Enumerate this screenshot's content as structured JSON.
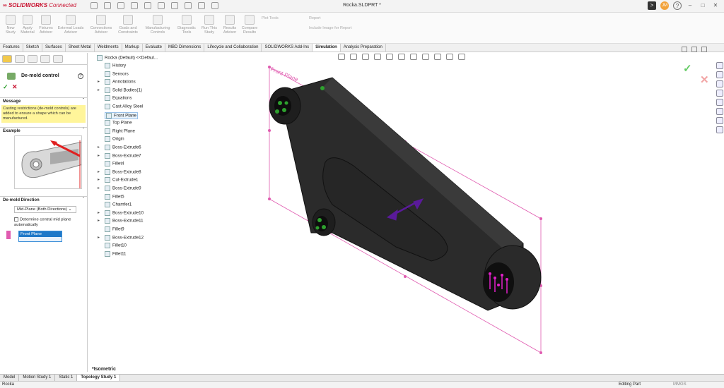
{
  "titlebar": {
    "brand": "SOLIDWORKS",
    "brand_suffix": "Connected",
    "document": "Rocka.SLDPRT *",
    "avatar": "JM"
  },
  "ribbon": {
    "buttons": [
      "New Study",
      "Apply Material",
      "Fixtures Advisor",
      "External Loads Advisor",
      "Connections Advisor",
      "Goals and Constraints",
      "Manufacturing Controls",
      "Diagnostic Tools",
      "Run This Study",
      "Results Advisor",
      "Compare Results"
    ],
    "plot_tools": "Plot Tools",
    "report": "Report",
    "include_image": "Include Image for Report"
  },
  "tabs": [
    "Features",
    "Sketch",
    "Surfaces",
    "Sheet Metal",
    "Weldments",
    "Markup",
    "Evaluate",
    "MBD Dimensions",
    "Lifecycle and Collaboration",
    "SOLIDWORKS Add-Ins",
    "Simulation",
    "Analysis Preparation"
  ],
  "active_tab": "Simulation",
  "property_manager": {
    "title": "De-mold control",
    "message_header": "Message",
    "message": "Casting restrictions (de-mold controls) are added to ensure a shape which can be manufactured.",
    "example_header": "Example",
    "direction_header": "De-mold Direction",
    "direction_value": "Mid-Plane (Both Directions)",
    "checkbox_label": "Determine central mid plane automatically",
    "selection": "Front Plane"
  },
  "tree": {
    "root": "Rocka (Default) <<Defaul...",
    "items": [
      "History",
      "Sensors",
      "Annotations",
      "Solid Bodies(1)",
      "Equations",
      "Cast Alloy Steel",
      "Front Plane",
      "Top Plane",
      "Right Plane",
      "Origin",
      "Boss-Extrude6",
      "Boss-Extrude7",
      "Fillet4",
      "Boss-Extrude8",
      "Cut-Extrude1",
      "Boss-Extrude9",
      "Fillet5",
      "Chamfer1",
      "Boss-Extrude10",
      "Boss-Extrude11",
      "Fillet9",
      "Boss-Extrude12",
      "Fillet10",
      "Fillet11"
    ]
  },
  "viewport": {
    "plane_label": "Front Plane",
    "view_label": "*Isometric"
  },
  "bottom_tabs": [
    "Model",
    "Motion Study 1",
    "Static 1",
    "Topology Study 1"
  ],
  "status": {
    "left": "Rocka",
    "mode": "Editing Part",
    "units": "MMGS"
  }
}
